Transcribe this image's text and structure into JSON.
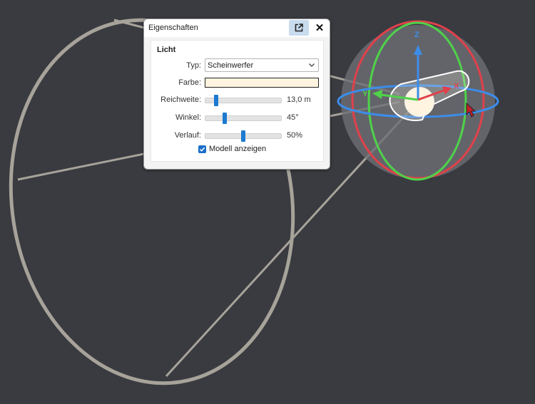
{
  "panel": {
    "title": "Eigenschaften",
    "popout_icon": "popout-icon",
    "close_icon": "close-icon",
    "close_glyph": "✕",
    "section_title": "Licht",
    "type_label": "Typ:",
    "type_value": "Scheinwerfer",
    "color_label": "Farbe:",
    "color_value": "#fff4df",
    "range_label": "Reichweite:",
    "range_value": "13,0 m",
    "range_level": 0.14,
    "angle_label": "Winkel:",
    "angle_value": "45°",
    "angle_level": 0.25,
    "falloff_label": "Verlauf:",
    "falloff_value": "50%",
    "falloff_level": 0.5,
    "show_model_label": "Modell anzeigen",
    "show_model_checked": true
  },
  "viewport": {
    "background": "#393b40",
    "gizmo_axis_x_label": "X",
    "gizmo_axis_y_label": "Y",
    "gizmo_axis_z_label": "Z",
    "axis_x_color": "#e0414b",
    "axis_y_color": "#4fd24a",
    "axis_z_color": "#3c8dea",
    "cone_color": "#a7a39a",
    "cursor_icon": "mouse-cursor-icon"
  }
}
